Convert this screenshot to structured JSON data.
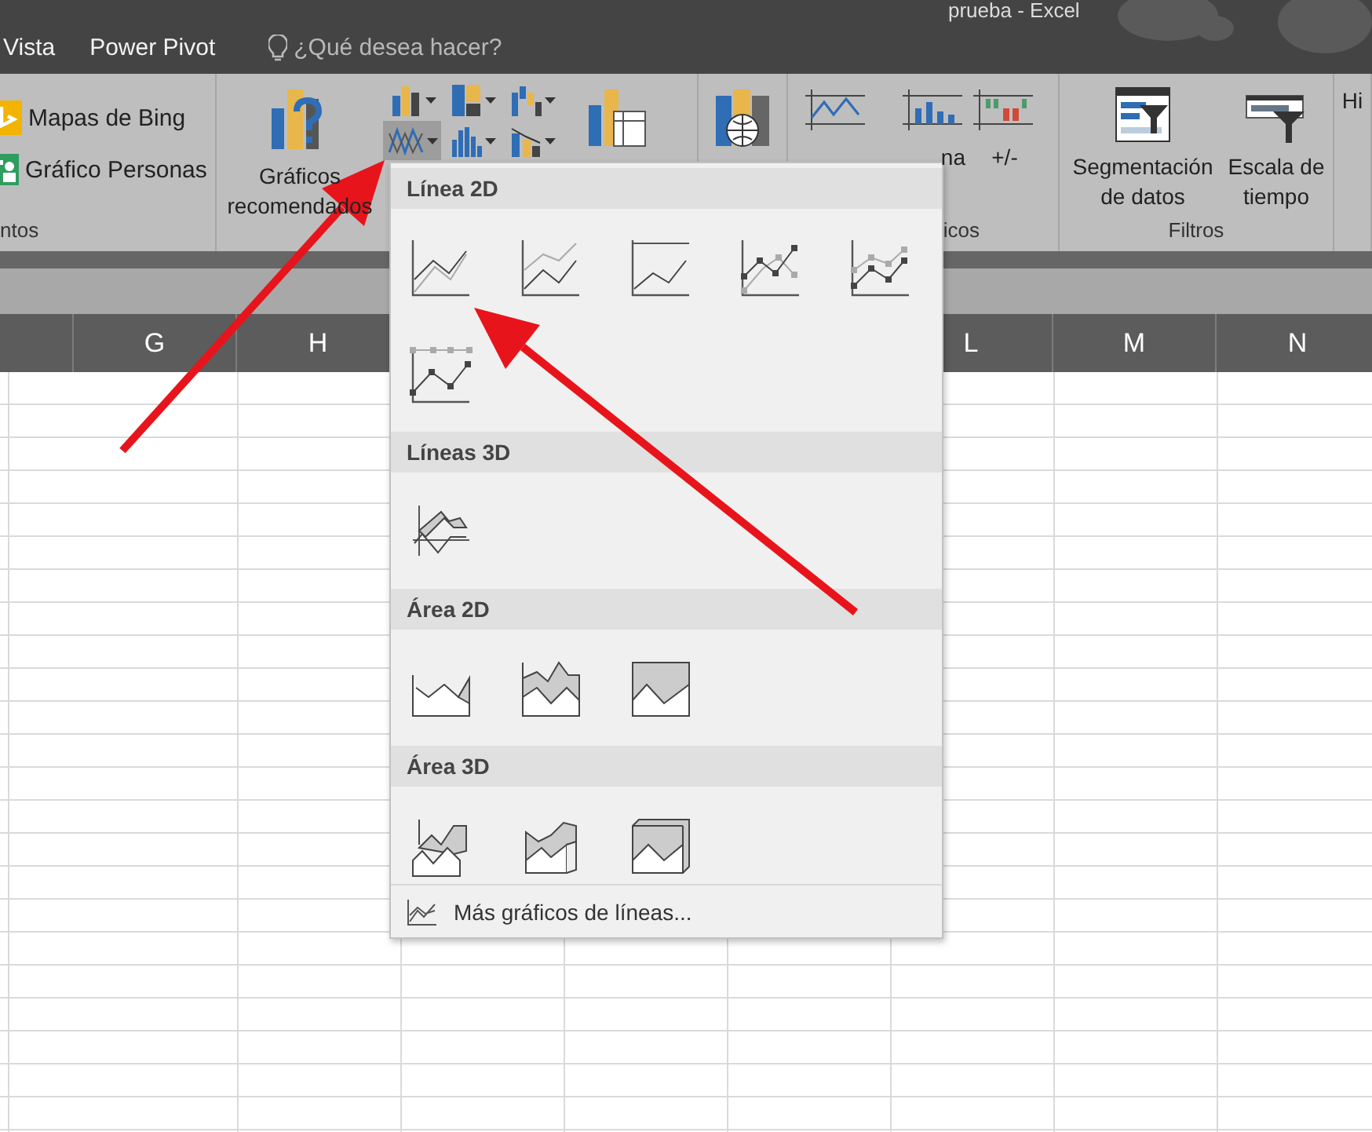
{
  "title_bar": {
    "title": "prueba - Excel"
  },
  "menu": {
    "tabs": [
      {
        "label": "Vista"
      },
      {
        "label": "Power Pivot"
      }
    ],
    "search": {
      "placeholder": "¿Qué desea hacer?"
    }
  },
  "ribbon": {
    "groups": [
      {
        "label": "ntos",
        "items": [
          {
            "kind": "small",
            "label": "Mapas de Bing"
          },
          {
            "kind": "small",
            "label": "Gráfico Personas"
          }
        ]
      },
      {
        "items": [
          {
            "kind": "large",
            "label": "Gráficos recomendados"
          },
          {
            "kind": "gallery",
            "cells": [
              {
                "selected": false
              },
              {
                "selected": false
              },
              {
                "selected": false
              },
              {
                "selected": true
              },
              {
                "selected": false
              },
              {
                "selected": false
              }
            ]
          },
          {
            "kind": "large"
          }
        ]
      },
      {
        "items": [
          {
            "kind": "large"
          }
        ]
      },
      {
        "label": "icos",
        "items": [
          {
            "kind": "large"
          },
          {
            "kind": "large",
            "label": "na"
          },
          {
            "kind": "large",
            "label": "+/-"
          }
        ]
      },
      {
        "label": "Filtros",
        "items": [
          {
            "kind": "large",
            "label": "Segmentación de datos"
          },
          {
            "kind": "large",
            "label": "Escala de tiempo"
          }
        ]
      },
      {
        "items": [
          {
            "kind": "large",
            "label": "Hi"
          }
        ]
      }
    ]
  },
  "sheet": {
    "columns": [
      {
        "label": "G"
      },
      {
        "label": "H"
      },
      {
        "label": "L"
      },
      {
        "label": "M"
      },
      {
        "label": "N"
      }
    ]
  },
  "dropdown": {
    "sections": [
      {
        "title": "Línea 2D",
        "items": [
          {
            "kind": "line"
          },
          {
            "kind": "stacked-line"
          },
          {
            "kind": "percent-line"
          },
          {
            "kind": "line-markers"
          },
          {
            "kind": "stacked-line-markers"
          },
          {
            "kind": "percent-line-markers"
          }
        ]
      },
      {
        "title": "Líneas 3D",
        "items": [
          {
            "kind": "line-3d"
          }
        ]
      },
      {
        "title": "Área 2D",
        "items": [
          {
            "kind": "area"
          },
          {
            "kind": "stacked-area"
          },
          {
            "kind": "percent-area"
          }
        ]
      },
      {
        "title": "Área 3D",
        "items": [
          {
            "kind": "area-3d"
          },
          {
            "kind": "stacked-area-3d"
          },
          {
            "kind": "percent-area-3d"
          }
        ]
      }
    ],
    "footer": {
      "label": "Más gráficos de líneas..."
    }
  }
}
